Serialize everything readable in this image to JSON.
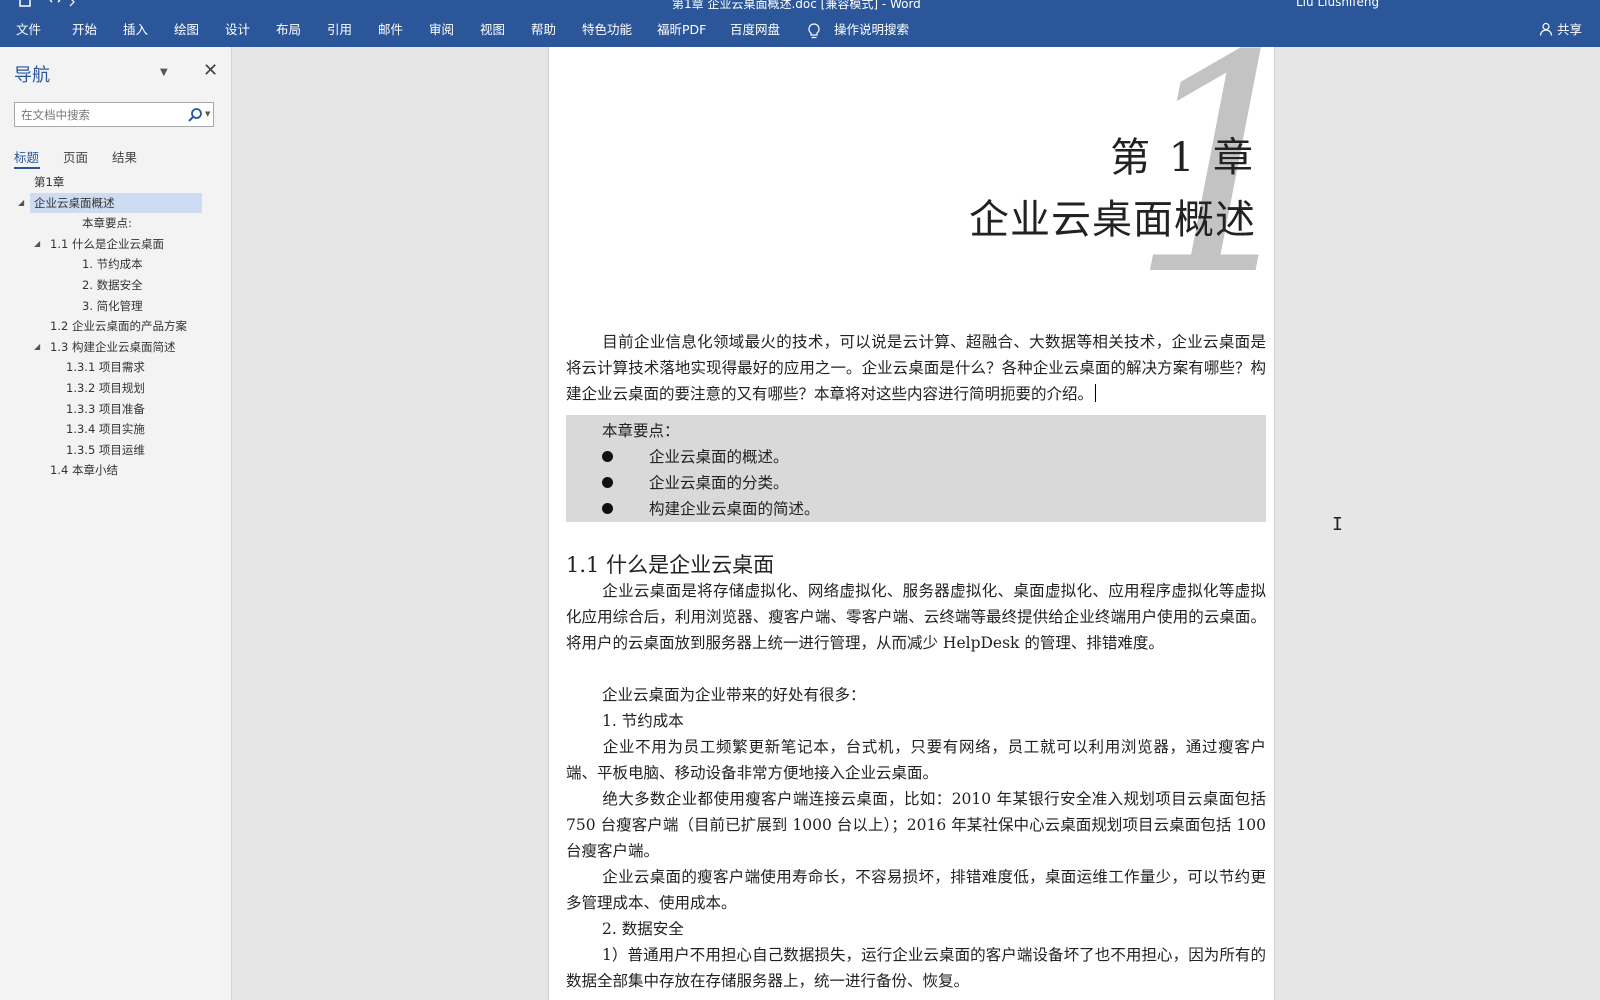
{
  "titlebar": {
    "doc_title": "第1章 企业云桌面概述.doc [兼容模式] - Word",
    "account": "Liu Liushifeng"
  },
  "menu": {
    "tabs": [
      "文件",
      "开始",
      "插入",
      "绘图",
      "设计",
      "布局",
      "引用",
      "邮件",
      "审阅",
      "视图",
      "帮助",
      "特色功能",
      "福昕PDF",
      "百度网盘"
    ],
    "tell_me": "操作说明搜索",
    "share": "共享",
    "ribbon_color": "#2b579a"
  },
  "nav": {
    "title": "导航",
    "search_placeholder": "在文档中搜索",
    "tabs": [
      "标题",
      "页面",
      "结果"
    ],
    "active_tab": "标题",
    "tree": [
      {
        "label": "第1章",
        "level": 0,
        "toggle": ""
      },
      {
        "label": "企业云桌面概述",
        "level": 0,
        "toggle": "◢",
        "selected": true
      },
      {
        "label": "本章要点:",
        "level": 3,
        "toggle": ""
      },
      {
        "label": "1.1   什么是企业云桌面",
        "level": 1,
        "toggle": "◢"
      },
      {
        "label": "1. 节约成本",
        "level": 3,
        "toggle": ""
      },
      {
        "label": "2. 数据安全",
        "level": 3,
        "toggle": ""
      },
      {
        "label": "3. 简化管理",
        "level": 3,
        "toggle": ""
      },
      {
        "label": "1.2   企业云桌面的产品方案",
        "level": 1,
        "toggle": ""
      },
      {
        "label": "1.3   构建企业云桌面简述",
        "level": 1,
        "toggle": "◢"
      },
      {
        "label": "1.3.1   项目需求",
        "level": 2,
        "toggle": ""
      },
      {
        "label": "1.3.2   项目规划",
        "level": 2,
        "toggle": ""
      },
      {
        "label": "1.3.3   项目准备",
        "level": 2,
        "toggle": ""
      },
      {
        "label": "1.3.4   项目实施",
        "level": 2,
        "toggle": ""
      },
      {
        "label": "1.3.5   项目运维",
        "level": 2,
        "toggle": ""
      },
      {
        "label": "1.4   本章小结",
        "level": 1,
        "toggle": ""
      }
    ]
  },
  "document": {
    "big_numeral": "1",
    "chapter_number": "第 1 章",
    "chapter_title": "企业云桌面概述",
    "intro": "目前企业信息化领域最火的技术，可以说是云计算、超融合、大数据等相关技术，企业云桌面是将云计算技术落地实现得最好的应用之一。企业云桌面是什么？各种企业云桌面的解决方案有哪些？构建企业云桌面的要注意的又有哪些？本章将对这些内容进行简明扼要的介绍。",
    "keypoints_title": "本章要点：",
    "keypoints": [
      "企业云桌面的概述。",
      "企业云桌面的分类。",
      "构建企业云桌面的简述。"
    ],
    "section_1_1": "1.1   什么是企业云桌面",
    "p1": "企业云桌面是将存储虚拟化、网络虚拟化、服务器虚拟化、桌面虚拟化、应用程序虚拟化等虚拟化应用综合后，利用浏览器、瘦客户端、零客户端、云终端等最终提供给企业终端用户使用的云桌面。将用户的云桌面放到服务器上统一进行管理，从而减少 HelpDesk 的管理、排错难度。",
    "p2": "企业云桌面为企业带来的好处有很多：",
    "h_save": "1.  节约成本",
    "p3": "企业不用为员工频繁更新笔记本，台式机，只要有网络，员工就可以利用浏览器，通过瘦客户端、平板电脑、移动设备非常方便地接入企业云桌面。",
    "p4": "绝大多数企业都使用瘦客户端连接云桌面，比如：2010 年某银行安全准入规划项目云桌面包括 750 台瘦客户端（目前已扩展到 1000 台以上）；2016 年某社保中心云桌面规划项目云桌面包括 100 台瘦客户端。",
    "p5": "企业云桌面的瘦客户端使用寿命长，不容易损坏，排错难度低，桌面运维工作量少，可以节约更多管理成本、使用成本。",
    "h_security": "2.  数据安全",
    "p6": "1）普通用户不用担心自己数据损失，运行企业云桌面的客户端设备坏了也不用担心，因为所有的数据全部集中存放在存储服务器上，统一进行备份、恢复。"
  }
}
